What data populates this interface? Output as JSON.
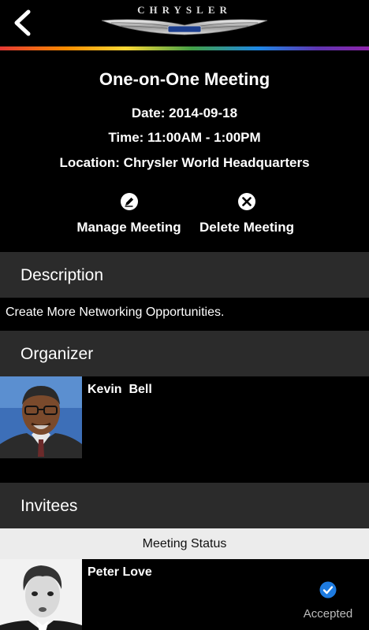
{
  "header": {
    "brand": "CHRYSLER",
    "back_icon": "chevron-left-icon",
    "rainbow_colors": [
      "#e53935",
      "#fb8c00",
      "#fdd835",
      "#43a047",
      "#1e88e5",
      "#5e35b1",
      "#8e24aa"
    ]
  },
  "meeting": {
    "title": "One-on-One Meeting",
    "date": "Date: 2014-09-18",
    "time": "Time: 11:00AM - 1:00PM",
    "location": "Location: Chrysler World Headquarters"
  },
  "actions": {
    "manage_label": "Manage Meeting",
    "manage_icon": "pencil-icon",
    "delete_label": "Delete Meeting",
    "delete_icon": "close-circle-icon"
  },
  "description": {
    "header": "Description",
    "text": "Create More Networking Opportunities."
  },
  "organizer": {
    "header": "Organizer",
    "name": "Kevin  Bell"
  },
  "invitees": {
    "header": "Invitees",
    "status_header": "Meeting Status",
    "items": [
      {
        "name": "Peter Love",
        "status": "Accepted",
        "status_icon": "check-circle-icon"
      }
    ]
  },
  "colors": {
    "background": "#000000",
    "section_bg": "#2b2b2b",
    "status_header_bg": "#ececec",
    "accent_blue": "#1e7be0"
  }
}
